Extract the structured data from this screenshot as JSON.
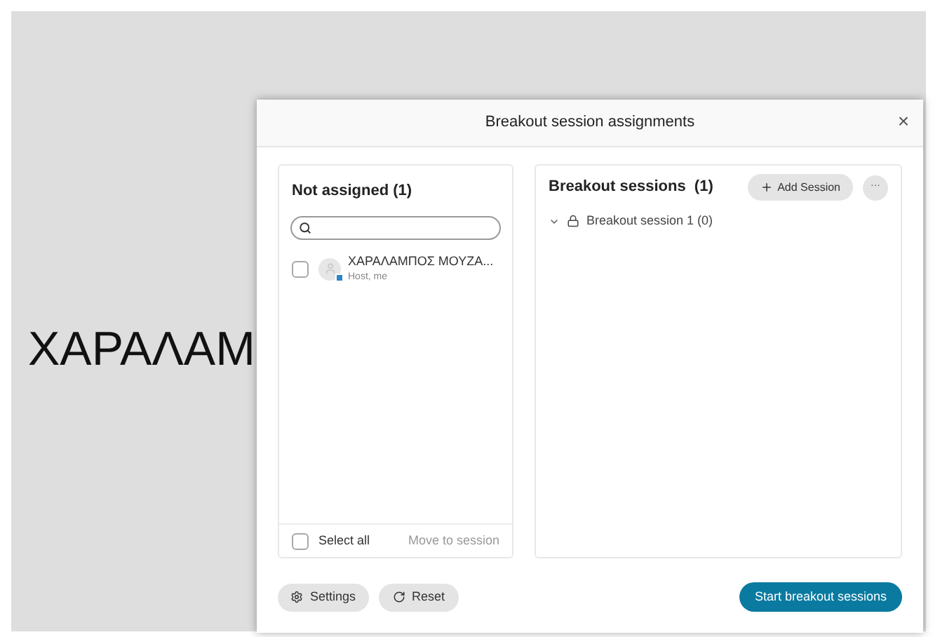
{
  "background_text": "ΧΑΡΑΛΑΜ",
  "dialog": {
    "title": "Breakout session assignments",
    "close": "×",
    "not_assigned": {
      "title": "Not assigned (1)",
      "participants": [
        {
          "name": "ΧΑΡΑΛΑΜΠΟΣ ΜΟΥΖΑ...",
          "role": "Host, me",
          "checked": false
        }
      ],
      "select_all": {
        "label": "Select all",
        "checked": false
      },
      "move": "Move to session"
    },
    "sessions": {
      "title": "Breakout sessions  (1)",
      "add": "Add Session",
      "more": "···",
      "items": [
        {
          "name": "Breakout session 1 (0)",
          "expanded": true
        }
      ]
    },
    "footer": {
      "settings": "Settings",
      "reset": "Reset",
      "start": "Start breakout sessions"
    }
  }
}
